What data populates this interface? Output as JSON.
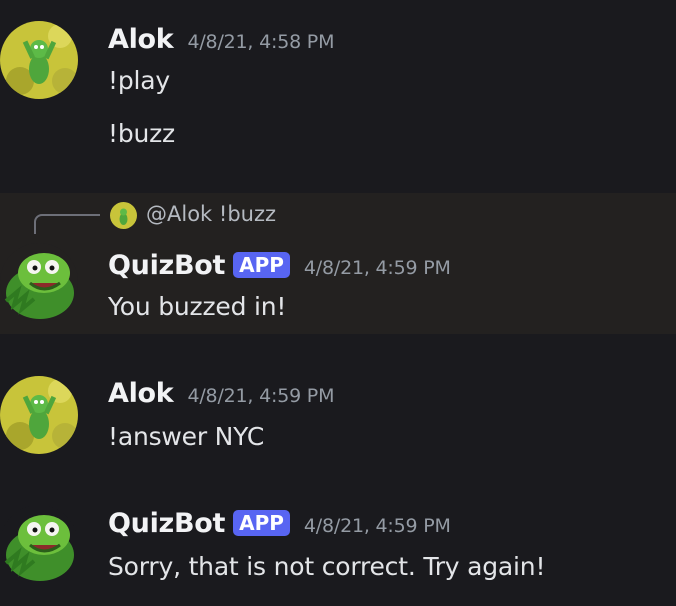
{
  "messages": [
    {
      "author": "Alok",
      "timestamp": "4/8/21, 4:58 PM",
      "lines": [
        "!play",
        "!buzz"
      ]
    },
    {
      "reply_to": {
        "mention": "@Alok",
        "text": "!buzz"
      },
      "author": "QuizBot",
      "badge": "APP",
      "timestamp": "4/8/21, 4:59 PM",
      "lines": [
        "You buzzed in!"
      ]
    },
    {
      "author": "Alok",
      "timestamp": "4/8/21, 4:59 PM",
      "lines": [
        "!answer NYC"
      ]
    },
    {
      "author": "QuizBot",
      "badge": "APP",
      "timestamp": "4/8/21, 4:59 PM",
      "lines": [
        "Sorry, that is not correct. Try again!"
      ]
    }
  ],
  "colors": {
    "background": "#1a1a1e",
    "highlight": "#232120",
    "badge": "#5865f2",
    "timestamp": "#949ba4"
  },
  "icons": {
    "alok_avatar": "kermit-in-field-avatar",
    "quizbot_avatar": "kermit-avatar"
  }
}
